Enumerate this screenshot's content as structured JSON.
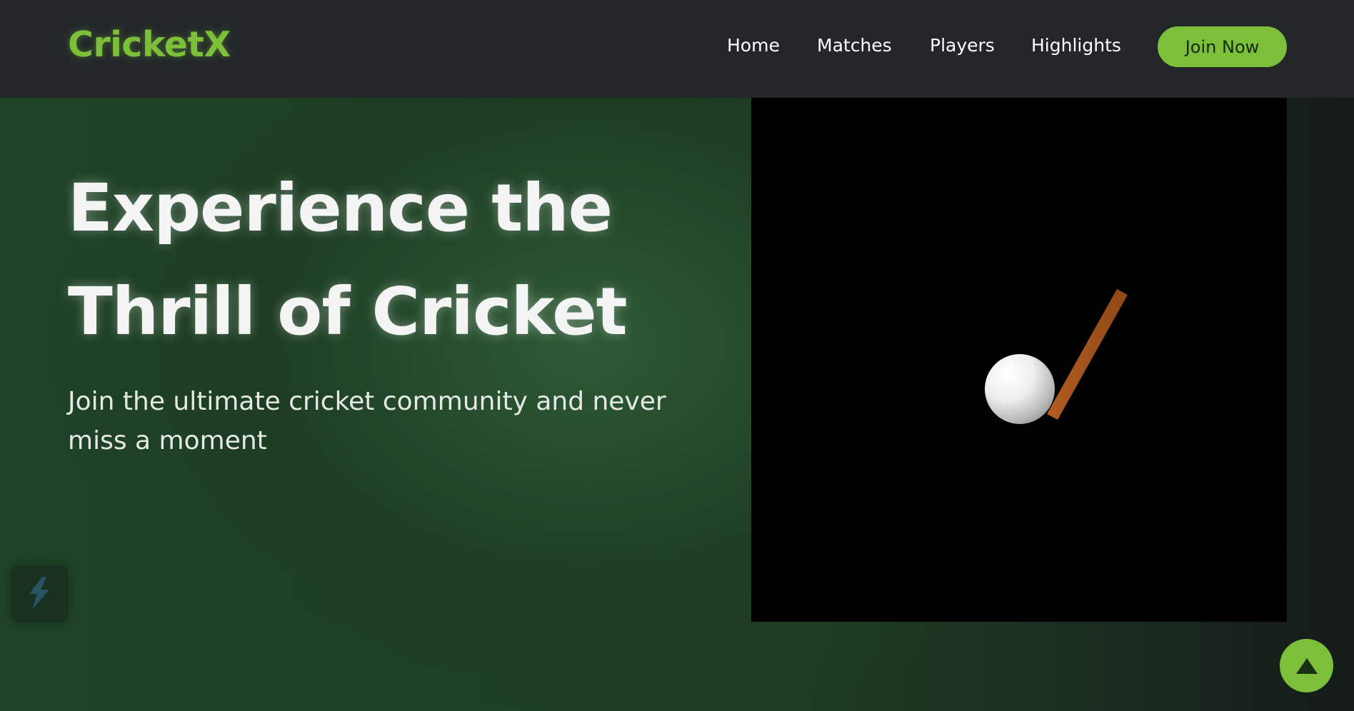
{
  "header": {
    "logo": "CricketX",
    "nav": [
      {
        "label": "Home"
      },
      {
        "label": "Matches"
      },
      {
        "label": "Players"
      },
      {
        "label": "Highlights"
      }
    ],
    "cta_label": "Join Now"
  },
  "hero": {
    "title_line1": "Experience the",
    "title_line2": "Thrill of Cricket",
    "subtitle_line1": "Join the ultimate cricket community and never",
    "subtitle_line2": "miss a moment"
  },
  "scene": {
    "objects": [
      "cricket-ball",
      "cricket-bat"
    ],
    "ball_color": "#ffffff",
    "bat_color": "#a0521c",
    "background": "#000000"
  },
  "icons": {
    "floating_widget": "bolt-icon",
    "scroll_top": "arrow-up-icon"
  },
  "colors": {
    "accent": "#7cc03a",
    "header_bg": "#23272a",
    "hero_green": "#24492b"
  }
}
